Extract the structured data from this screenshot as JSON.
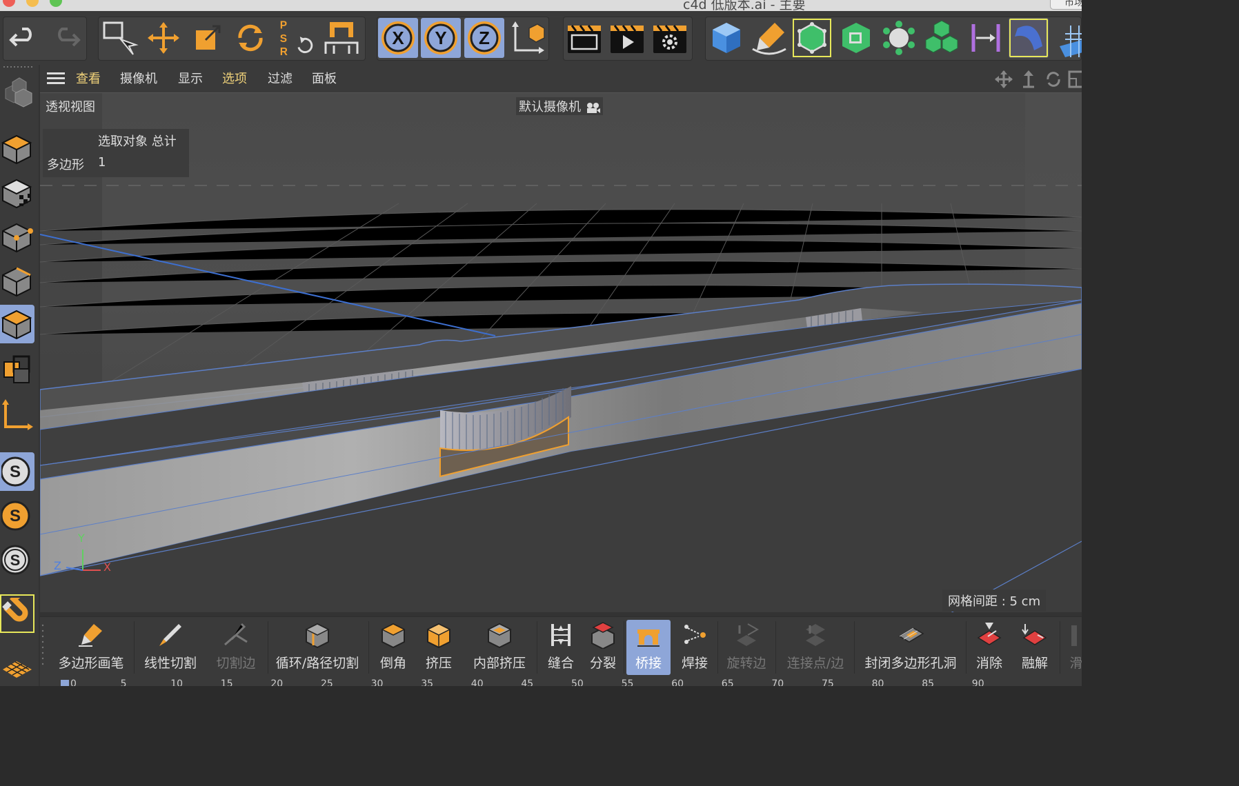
{
  "window": {
    "title": "c4d 低版本.ai - 主要",
    "right_button": "市场"
  },
  "colors": {
    "accent": "#8ea6d8",
    "selection": "#f0a030",
    "highlight_text": "#f0d27a",
    "axis_x": "#e05050",
    "axis_y": "#60d060",
    "axis_z": "#5080e0"
  },
  "toolbar": {
    "buttons": [
      "undo-icon",
      "redo-icon",
      "select-icon",
      "move-icon",
      "scale-icon",
      "rotate-icon",
      "psr-icon",
      "coordinate-icon",
      "x-axis-lock",
      "y-axis-lock",
      "z-axis-lock",
      "world-coord-icon",
      "render-view-icon",
      "render-picture-viewer-icon",
      "render-settings-icon",
      "cube-icon",
      "pen-icon",
      "subdivision-icon",
      "extrude-gen-icon",
      "cloner-icon",
      "array-icon",
      "symmetry-icon",
      "deformer-icon",
      "floor-icon"
    ],
    "psr_letters": [
      "P",
      "S",
      "R"
    ],
    "axis_x": "X",
    "axis_y": "Y",
    "axis_z": "Z"
  },
  "viewport_menu": {
    "items": [
      {
        "label": "查看",
        "highlight": true
      },
      {
        "label": "摄像机",
        "highlight": false
      },
      {
        "label": "显示",
        "highlight": false
      },
      {
        "label": "选项",
        "highlight": true
      },
      {
        "label": "过滤",
        "highlight": false
      },
      {
        "label": "面板",
        "highlight": false
      }
    ]
  },
  "viewport": {
    "view_name": "透视视图",
    "camera": "默认摄像机",
    "stats_header": "选取对象  总计",
    "stats_row_label": "多边形",
    "stats_row_value": "1",
    "grid_spacing": "网格间距 : 5 cm",
    "axis_y": "Y",
    "axis_z": "Z",
    "axis_x": "X"
  },
  "bottom_toolbar": {
    "tools": [
      {
        "label": "多边形画笔",
        "enabled": true,
        "active": false,
        "icon": "polygon-pen-icon"
      },
      {
        "label": "线性切割",
        "enabled": true,
        "active": false,
        "icon": "knife-icon"
      },
      {
        "label": "切割边",
        "enabled": false,
        "active": false,
        "icon": "edge-cut-icon"
      },
      {
        "label": "循环/路径切割",
        "enabled": true,
        "active": false,
        "icon": "loop-cut-icon"
      },
      {
        "label": "倒角",
        "enabled": true,
        "active": false,
        "icon": "bevel-icon"
      },
      {
        "label": "挤压",
        "enabled": true,
        "active": false,
        "icon": "extrude-icon"
      },
      {
        "label": "内部挤压",
        "enabled": true,
        "active": false,
        "icon": "inner-extrude-icon"
      },
      {
        "label": "缝合",
        "enabled": true,
        "active": false,
        "icon": "stitch-icon"
      },
      {
        "label": "分裂",
        "enabled": true,
        "active": false,
        "icon": "split-icon"
      },
      {
        "label": "桥接",
        "enabled": true,
        "active": true,
        "icon": "bridge-icon"
      },
      {
        "label": "焊接",
        "enabled": true,
        "active": false,
        "icon": "weld-icon"
      },
      {
        "label": "旋转边",
        "enabled": false,
        "active": false,
        "icon": "spin-edge-icon"
      },
      {
        "label": "连接点/边",
        "enabled": false,
        "active": false,
        "icon": "connect-icon"
      },
      {
        "label": "封闭多边形孔洞",
        "enabled": true,
        "active": false,
        "icon": "close-hole-icon"
      },
      {
        "label": "消除",
        "enabled": true,
        "active": false,
        "icon": "dissolve-icon"
      },
      {
        "label": "融解",
        "enabled": true,
        "active": false,
        "icon": "melt-icon"
      },
      {
        "label": "滑",
        "enabled": false,
        "active": false,
        "icon": "slide-icon"
      }
    ]
  },
  "timeline": {
    "ticks": [
      "0",
      "5",
      "10",
      "15",
      "20",
      "25",
      "30",
      "35",
      "40",
      "45",
      "50",
      "55",
      "60",
      "65",
      "70",
      "75",
      "80",
      "85",
      "90"
    ]
  }
}
